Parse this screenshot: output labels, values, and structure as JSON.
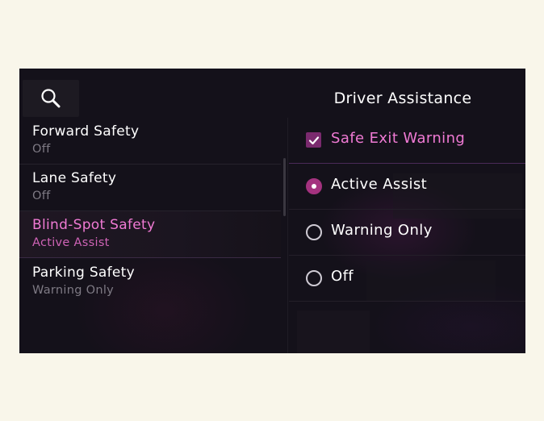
{
  "header": {
    "title": "Driver Assistance",
    "search_icon": "search-icon"
  },
  "sidebar": {
    "items": [
      {
        "title": "Forward Safety",
        "value": "Off",
        "selected": false
      },
      {
        "title": "Lane Safety",
        "value": "Off",
        "selected": false
      },
      {
        "title": "Blind-Spot Safety",
        "value": "Active Assist",
        "selected": true
      },
      {
        "title": "Parking Safety",
        "value": "Warning Only",
        "selected": false
      }
    ]
  },
  "options": {
    "checkbox": {
      "label": "Safe Exit Warning",
      "checked": true
    },
    "radios": [
      {
        "label": "Active Assist",
        "selected": true
      },
      {
        "label": "Warning Only",
        "selected": false
      },
      {
        "label": "Off",
        "selected": false
      }
    ]
  },
  "colors": {
    "accent": "#f07ad4",
    "accent_dark": "#a4327f",
    "background": "#14111a",
    "page_background": "#f9f6ea"
  }
}
